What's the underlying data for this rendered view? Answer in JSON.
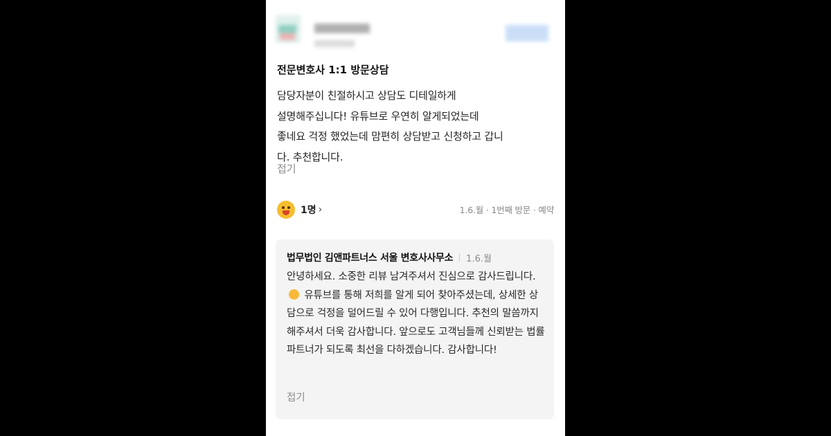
{
  "review": {
    "title": "전문변호사 1:1 방문상담",
    "body": "담당자분이 친절하시고 상담도 디테일하게\n설명해주십니다! 유튜브로 우연히 알게되었는데\n좋네요 걱정 했었는데 맘편히 상담받고 신청하고 갑니\n다. 추천합니다.",
    "fold_label": "접기",
    "reaction_count": "1명",
    "reaction_chevron": "›",
    "meta": "1.6.월 · 1번째 방문 · 예약"
  },
  "reply": {
    "author": "법무법인 김앤파트너스 서울 변호사사무소",
    "date": "1.6.월",
    "text_before_emoji": "안녕하세요. 소중한 리뷰 남겨주셔서 진심으로 감사드립니다.",
    "text_after_emoji": " 유튜브를 통해 저희를 알게 되어 찾아주셨는데, 상세한 상담으로 걱정을 덜어드릴 수 있어 다행입니다. 추천의 말씀까지 해주셔서 더욱 감사합니다. 앞으로도 고객님들께 신뢰받는 법률 파트너가 되도록 최선을 다하겠습니다. 감사합니다!",
    "fold_label": "접기"
  },
  "colors": {
    "background": "#000000",
    "card": "#ffffff",
    "reply_bg": "#f4f4f5",
    "muted_text": "#8a8a8a"
  },
  "icons": {
    "reaction": "face-emoji-icon",
    "reply_emoji": "smile-emoji-icon"
  }
}
